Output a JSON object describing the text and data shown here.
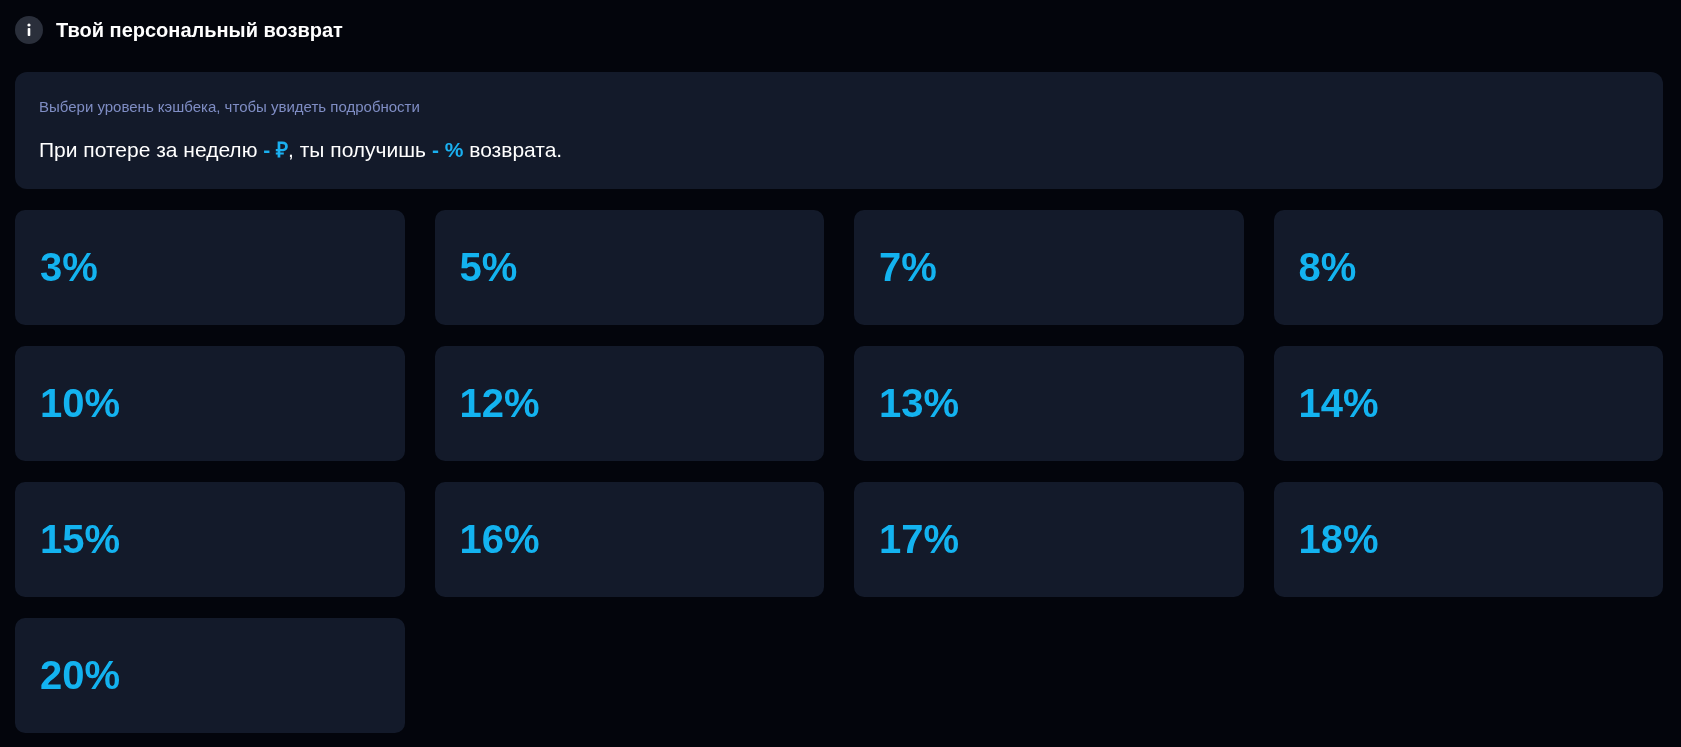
{
  "header": {
    "title": "Твой персональный возврат"
  },
  "info": {
    "hint": "Выбери уровень кэшбека, чтобы увидеть подробности",
    "sentence": "При потере за неделю **- ₽**, ты получишь **- %** возврата."
  },
  "levels": [
    {
      "label": "3%",
      "selected": false
    },
    {
      "label": "5%",
      "selected": false
    },
    {
      "label": "7%",
      "selected": false
    },
    {
      "label": "8%",
      "selected": false
    },
    {
      "label": "10%",
      "selected": false
    },
    {
      "label": "12%",
      "selected": false
    },
    {
      "label": "13%",
      "selected": false
    },
    {
      "label": "14%",
      "selected": false
    },
    {
      "label": "15%",
      "selected": false
    },
    {
      "label": "16%",
      "selected": false
    },
    {
      "label": "17%",
      "selected": false
    },
    {
      "label": "18%",
      "selected": false
    },
    {
      "label": "20%",
      "selected": false
    }
  ]
}
